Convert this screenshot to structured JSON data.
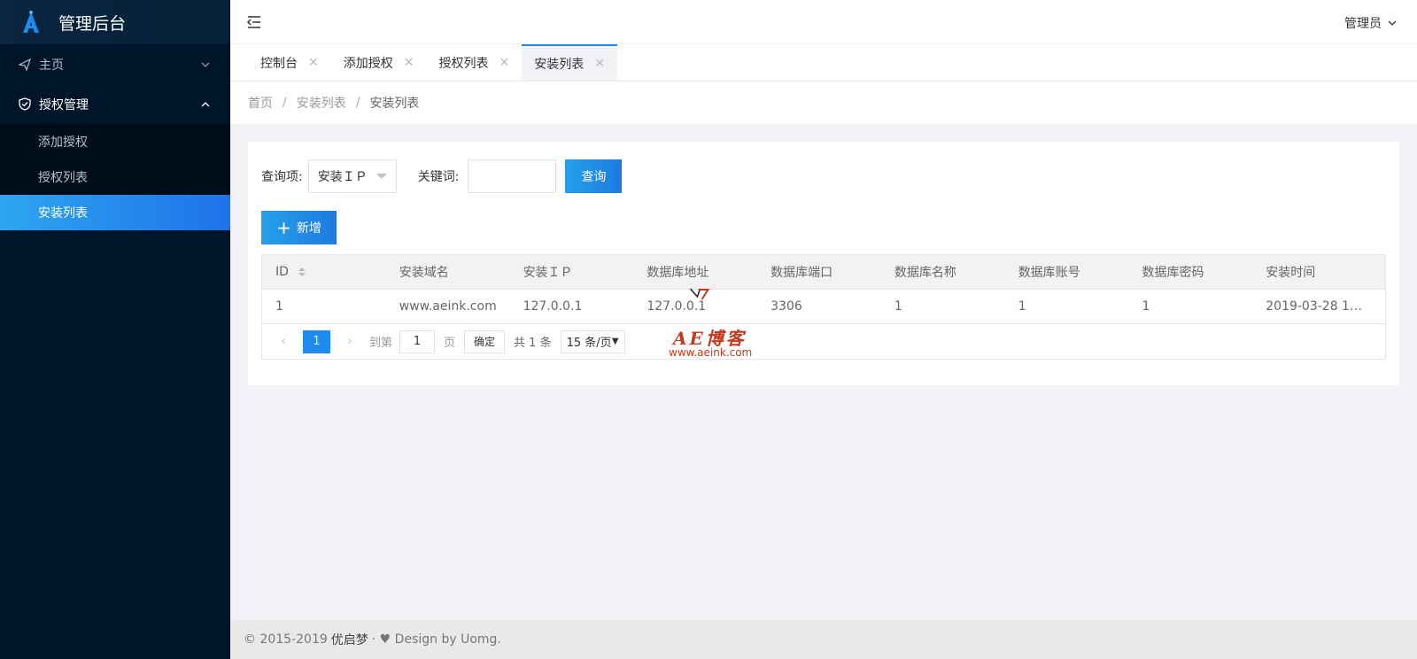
{
  "brand": {
    "title": "管理后台",
    "logo_icon": "a-logo-icon",
    "accent": "#1d8cf0"
  },
  "sidebar": {
    "items": [
      {
        "label": "主页",
        "icon": "send-icon"
      },
      {
        "label": "授权管理",
        "icon": "shield-check-icon",
        "expanded": true,
        "children": [
          {
            "label": "添加授权"
          },
          {
            "label": "授权列表"
          },
          {
            "label": "安装列表",
            "active": true
          }
        ]
      }
    ]
  },
  "header": {
    "user": "管理员"
  },
  "tabs": [
    {
      "label": "控制台"
    },
    {
      "label": "添加授权"
    },
    {
      "label": "授权列表"
    },
    {
      "label": "安装列表",
      "active": true
    }
  ],
  "breadcrumb": {
    "items": [
      "首页",
      "安装列表",
      "安装列表"
    ],
    "separator": "/"
  },
  "search": {
    "field_label": "查询项:",
    "field_value": "安装ＩＰ",
    "keyword_label": "关键词:",
    "keyword_value": "",
    "query_button": "查询",
    "add_button": "新增"
  },
  "table": {
    "columns": [
      "ID",
      "安装域名",
      "安装ＩＰ",
      "数据库地址",
      "数据库端口",
      "数据库名称",
      "数据库账号",
      "数据库密码",
      "安装时间"
    ],
    "rows": [
      [
        "1",
        "www.aeink.com",
        "127.0.0.1",
        "127.0.0.1",
        "3306",
        "1",
        "1",
        "1",
        "2019-03-28 11:..."
      ]
    ]
  },
  "pager": {
    "current_page": "1",
    "goto_label": "到第",
    "goto_value": "1",
    "page_label": "页",
    "confirm": "确定",
    "total": "共 1 条",
    "page_size": "15 条/页"
  },
  "watermark": {
    "text": "AE博客",
    "url": "www.aeink.com"
  },
  "footer": {
    "copyright": "© 2015-2019",
    "name": "优启梦",
    "design": "· ♥ Design by Uomg."
  }
}
